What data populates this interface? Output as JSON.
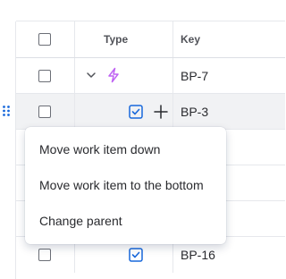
{
  "table": {
    "columns": {
      "type": "Type",
      "key": "Key"
    },
    "rows": [
      {
        "key": "BP-7",
        "type_icon": "lightning-epic-icon"
      },
      {
        "key": "BP-3",
        "type_icon": "checkbox-task-icon"
      },
      {
        "key": "",
        "type_icon": ""
      },
      {
        "key": "",
        "type_icon": ""
      },
      {
        "key": "",
        "type_icon": ""
      },
      {
        "key": "BP-16",
        "type_icon": "checkbox-task-icon"
      }
    ]
  },
  "context_menu": {
    "items": [
      {
        "label": "Move work item down"
      },
      {
        "label": "Move work item to the bottom"
      },
      {
        "label": "Change parent"
      }
    ]
  },
  "colors": {
    "accent_blue": "#1868db",
    "epic_purple": "#bf63f3",
    "hover_row": "#f1f2f4",
    "border": "#e6e8ec"
  }
}
